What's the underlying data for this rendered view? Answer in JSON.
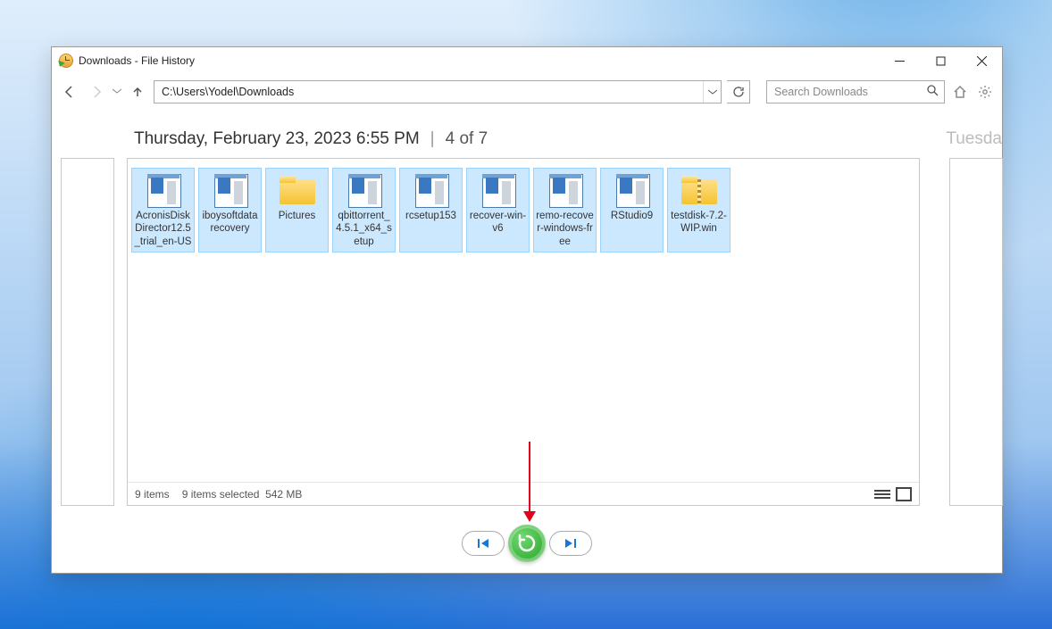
{
  "window": {
    "title": "Downloads - File History"
  },
  "toolbar": {
    "path": "C:\\Users\\Yodel\\Downloads",
    "search_placeholder": "Search Downloads"
  },
  "datestrip": {
    "date": "Thursday, February 23, 2023 6:55 PM",
    "count": "4 of 7",
    "next_label": "Tuesda"
  },
  "files": [
    {
      "name": "AcronisDiskDirector12.5_trial_en-US",
      "type": "app",
      "selected": true
    },
    {
      "name": "iboysoftdatarecovery",
      "type": "app",
      "selected": true
    },
    {
      "name": "Pictures",
      "type": "folder",
      "selected": true
    },
    {
      "name": "qbittorrent_4.5.1_x64_setup",
      "type": "app",
      "selected": true
    },
    {
      "name": "rcsetup153",
      "type": "app",
      "selected": true
    },
    {
      "name": "recover-win-v6",
      "type": "app",
      "selected": true
    },
    {
      "name": "remo-recover-windows-free",
      "type": "app",
      "selected": true
    },
    {
      "name": "RStudio9",
      "type": "app",
      "selected": true
    },
    {
      "name": "testdisk-7.2-WIP.win",
      "type": "zip",
      "selected": true
    }
  ],
  "status": {
    "items": "9 items",
    "selected": "9 items selected",
    "size": "542 MB"
  }
}
